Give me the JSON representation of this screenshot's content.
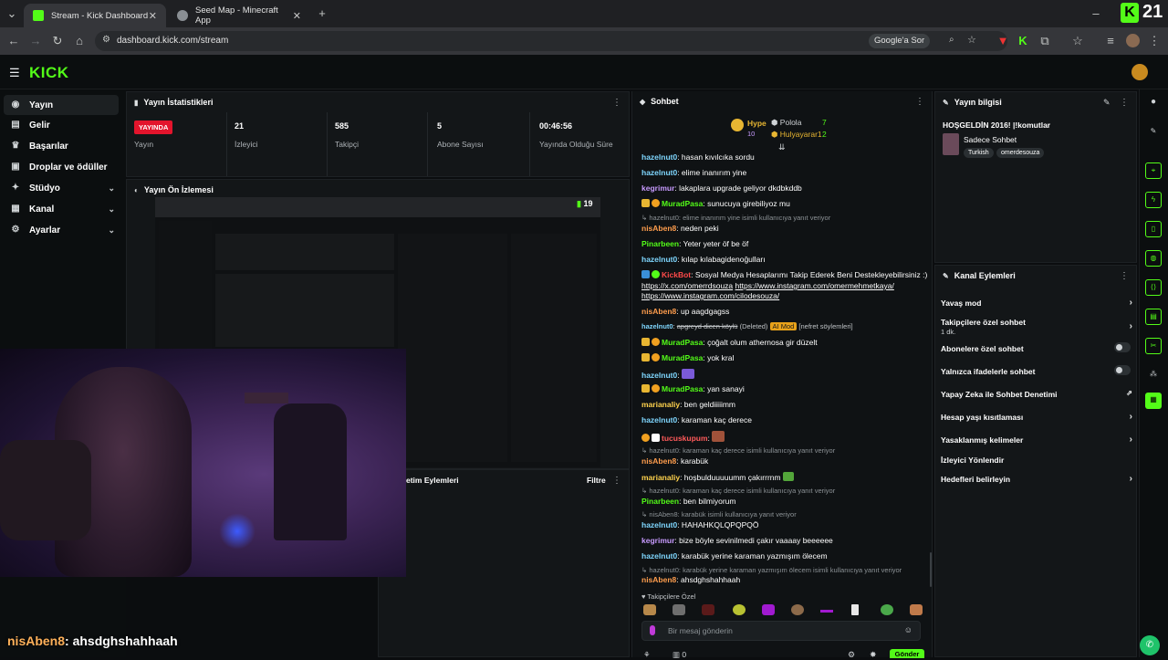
{
  "browser": {
    "tabs": [
      {
        "title": "Stream - Kick Dashboard",
        "favicon_color": "#53fc18"
      },
      {
        "title": "Seed Map - Minecraft App",
        "favicon_color": "#8a8f94"
      }
    ],
    "url": "dashboard.kick.com/stream",
    "google_button": "Google'a Sor",
    "badge_number": "21"
  },
  "header": {
    "logo": "KICK"
  },
  "sidebar": {
    "items": [
      {
        "label": "Yayın",
        "icon": "broadcast-icon"
      },
      {
        "label": "Gelir",
        "icon": "wallet-icon"
      },
      {
        "label": "Başarılar",
        "icon": "trophy-icon"
      },
      {
        "label": "Droplar ve ödüller",
        "icon": "gift-icon"
      },
      {
        "label": "Stüdyo",
        "icon": "studio-icon"
      },
      {
        "label": "Kanal",
        "icon": "channel-icon"
      },
      {
        "label": "Ayarlar",
        "icon": "gear-icon"
      }
    ]
  },
  "stats": {
    "title": "Yayın İstatistikleri",
    "live_badge": "YAYINDA",
    "items": [
      {
        "value": "",
        "label": "Yayın"
      },
      {
        "value": "21",
        "label": "İzleyici"
      },
      {
        "value": "585",
        "label": "Takipçi"
      },
      {
        "value": "5",
        "label": "Abone Sayısı"
      },
      {
        "value": "00:46:56",
        "label": "Yayında Olduğu Süre"
      }
    ]
  },
  "preview": {
    "title": "Yayın Ön İzlemesi",
    "viewer_count": "19"
  },
  "actions_panel": {
    "title": "etim Eylemleri",
    "filter": "Filtre"
  },
  "overlay": {
    "user": "nisAben8",
    "text": ": ahsdghshahhaah"
  },
  "chat": {
    "title": "Sohbet",
    "hype": "Hype",
    "hype_count": "10",
    "top": [
      {
        "name": "Polola",
        "count": "7"
      },
      {
        "name": "Hulyayarar1",
        "count": "2"
      }
    ],
    "messages": [
      {
        "user": "hazelnut0",
        "color": "#7fd7ff",
        "text": ": hasan kıvılcıka sordu"
      },
      {
        "user": "hazelnut0",
        "color": "#7fd7ff",
        "text": ": elime inanırım yine"
      },
      {
        "user": "kegrimur",
        "color": "#c89bff",
        "text": ": lakaplara upgrade geliyor dkdbkddb"
      },
      {
        "user": "MuradPasa",
        "color": "#53fc18",
        "text": ": sunucuya girebiliyoz mu"
      },
      {
        "user": "nisAben8",
        "color": "#ff9d4d",
        "text": ": neden peki"
      },
      {
        "user": "Pinarbeen",
        "color": "#53fc18",
        "text": ": Yeter yeter öf be öf"
      },
      {
        "user": "hazelnut0",
        "color": "#7fd7ff",
        "text": ": kılap kılabagidenoğulları"
      },
      {
        "user": "nisAben8",
        "color": "#ff9d4d",
        "text": ": up aagdgagss"
      },
      {
        "user": "MuradPasa",
        "color": "#53fc18",
        "text": ": çoğalt olum athernosa gir düzelt"
      },
      {
        "user": "MuradPasa",
        "color": "#53fc18",
        "text": ": yok kral"
      },
      {
        "user": "hazelnut0",
        "color": "#7fd7ff",
        "text": ":"
      },
      {
        "user": "MuradPasa",
        "color": "#53fc18",
        "text": ": yan sanayi"
      },
      {
        "user": "marianaliy",
        "color": "#ffd24d",
        "text": ": ben geldiiiiimm"
      },
      {
        "user": "hazelnut0",
        "color": "#7fd7ff",
        "text": ": karaman kaç derece"
      },
      {
        "user": "tucuskupum",
        "color": "#ff5a5a",
        "text": ":"
      },
      {
        "user": "nisAben8",
        "color": "#ff9d4d",
        "text": ": karabük"
      },
      {
        "user": "marianaliy",
        "color": "#ffd24d",
        "text": ": hoşbulduuuuumm çakırrrnm"
      },
      {
        "user": "Pinarbeen",
        "color": "#53fc18",
        "text": ": ben bilmiyorum"
      },
      {
        "user": "hazelnut0",
        "color": "#7fd7ff",
        "text": ": HAHAHKQLQPQPQÖ"
      },
      {
        "user": "kegrimur",
        "color": "#c89bff",
        "text": ": bize böyle sevinilmedi çakır vaaaay beeeeee"
      },
      {
        "user": "hazelnut0",
        "color": "#7fd7ff",
        "text": ": karabük yerine karaman yazmışım ölecem"
      },
      {
        "user": "nisAben8",
        "color": "#ff9d4d",
        "text": ": ahsdghshahhaah"
      }
    ],
    "replies": [
      "hazelnut0: elime inanırım yine isimli kullanıcıya yanıt veriyor",
      "hazelnut0: karaman kaç derece isimli kullanıcıya yanıt veriyor",
      "hazelnut0: karaman kaç derece isimli kullanıcıya yanıt veriyor",
      "nisAben8: karabük isimli kullanıcıya yanıt veriyor",
      "hazelnut0: karabük yerine karaman yazmışım ölecem isimli kullanıcıya yanıt veriyor"
    ],
    "bot": {
      "user": "KickBot",
      "text": ": Sosyal Medya Hesaplarımı Takip Ederek Beni Destekleyebilirsiniz :)",
      "link1": "https://x.com/omerrdsouza",
      "link2": "https://www.instagram.com/omermehmetkaya/",
      "link3": "https://www.instagram.com/cilodesouza/"
    },
    "deleted": {
      "user": "hazelnut0",
      "text": "apgreyd dicen köylü",
      "tag": "(Deleted)",
      "ai": "AI Mod",
      "reason": "[nefret söylemleri]"
    },
    "followers_only": "Takipçilere Özel",
    "placeholder": "Bir mesaj gönderin",
    "send": "Gönder",
    "points": "0"
  },
  "stream_info": {
    "title": "Yayın bilgisi",
    "stream_title": "HOŞGELDİN 2016! |!komutlar",
    "category": "Sadece Sohbet",
    "tags": [
      "Turkish",
      "omerdesouza"
    ]
  },
  "channel_actions": {
    "title": "Kanal Eylemleri",
    "items": [
      {
        "label": "Yavaş mod",
        "type": "chevron"
      },
      {
        "label": "Takipçilere özel sohbet",
        "sub": "1 dk.",
        "type": "chevron"
      },
      {
        "label": "Abonelere özel sohbet",
        "type": "toggle"
      },
      {
        "label": "Yalnızca ifadelerle sohbet",
        "type": "toggle"
      },
      {
        "label": "Yapay Zeka ile Sohbet Denetimi",
        "type": "external"
      },
      {
        "label": "Hesap yaşı kısıtlaması",
        "type": "chevron"
      },
      {
        "label": "Yasaklanmış kelimeler",
        "type": "chevron"
      },
      {
        "label": "İzleyici Yönlendir",
        "type": "none"
      },
      {
        "label": "Hedefleri belirleyin",
        "type": "chevron"
      }
    ]
  },
  "colors": {
    "accent": "#53fc18",
    "live": "#e3142c",
    "panel": "#131618"
  }
}
